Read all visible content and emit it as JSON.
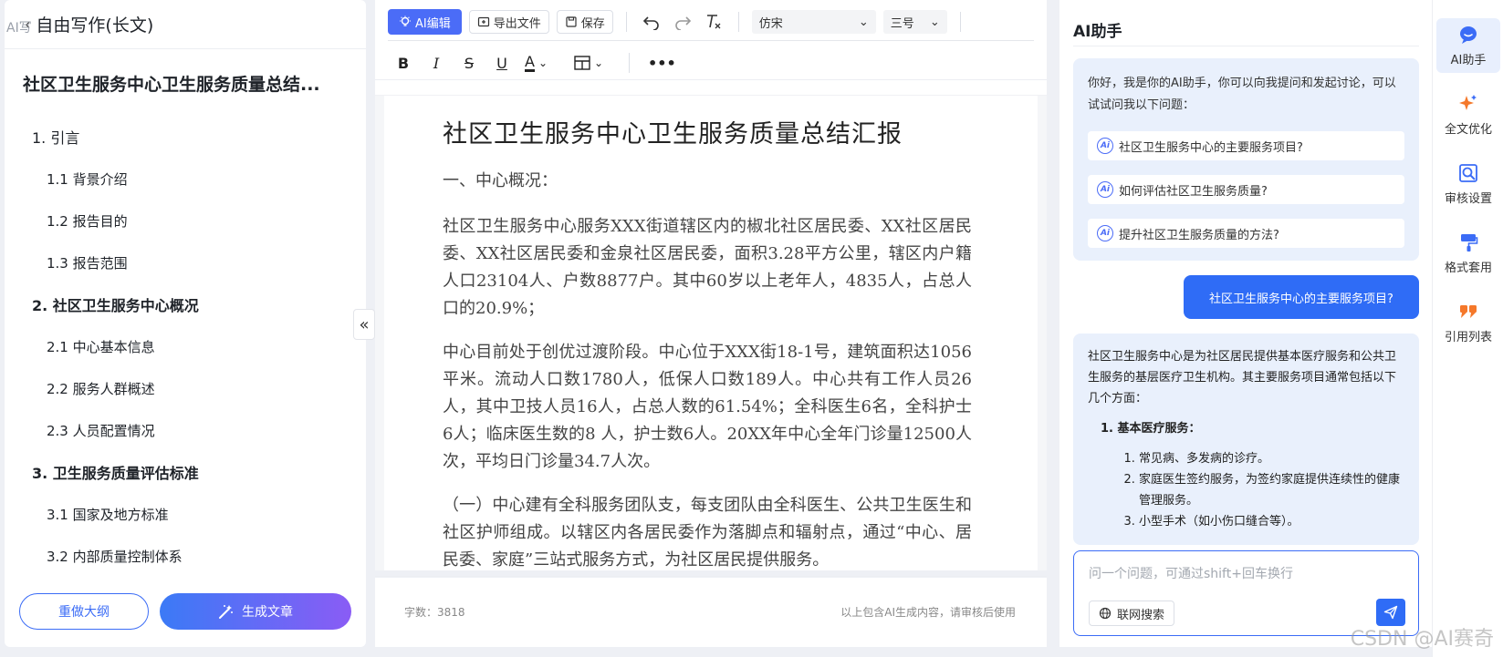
{
  "left": {
    "ghost_label": "AI写",
    "header_title": "自由写作(长文)",
    "doc_title": "社区卫生服务中心卫生服务质量总结...",
    "outline": [
      {
        "level": 1,
        "label": "1. 引言"
      },
      {
        "level": 2,
        "label": "1.1 背景介绍"
      },
      {
        "level": 2,
        "label": "1.2 报告目的"
      },
      {
        "level": 2,
        "label": "1.3 报告范围"
      },
      {
        "level": 1,
        "label": "2. 社区卫生服务中心概况"
      },
      {
        "level": 2,
        "label": "2.1 中心基本信息"
      },
      {
        "level": 2,
        "label": "2.2 服务人群概述"
      },
      {
        "level": 2,
        "label": "2.3 人员配置情况"
      },
      {
        "level": 1,
        "label": "3. 卫生服务质量评估标准"
      },
      {
        "level": 2,
        "label": "3.1 国家及地方标准"
      },
      {
        "level": 2,
        "label": "3.2 内部质量控制体系"
      }
    ],
    "redo_label": "重做大纲",
    "generate_label": "生成文章"
  },
  "toolbar": {
    "ai_edit_label": "AI编辑",
    "export_label": "导出文件",
    "save_label": "保存",
    "font_value": "仿宋",
    "size_value": "三号"
  },
  "document": {
    "title": "社区卫生服务中心卫生服务质量总结汇报",
    "section": "一、中心概况：",
    "paragraphs": [
      "社区卫生服务中心服务XXX街道辖区内的椒北社区居民委、XX社区居民委、XX社区居民委和金泉社区居民委，面积3.28平方公里，辖区内户籍人口23104人、户数8877户。其中60岁以上老年人，4835人，占总人口的20.9%；",
      "中心目前处于创优过渡阶段。中心位于XXX街18-1号，建筑面积达1056平米。流动人口数1780人，低保人口数189人。中心共有工作人员26人，其中卫技人员16人，占总人数的61.54%；全科医生6名，全科护士6人；临床医生数的8 人，护士数6人。20XX年中心全年门诊量12500人次，平均日门诊量34.7人次。",
      "（一）中心建有全科服务团队支，每支团队由全科医生、公共卫生医生和社区护师组成。以辖区内各居民委作为落脚点和辐射点，通过“中心、居民委、家庭”三站式服务方式，为社区居民提供服务。"
    ]
  },
  "editor_footer": {
    "word_count": "字数：3818",
    "disclaimer": "以上包含AI生成内容，请审核后使用"
  },
  "assistant": {
    "title": "AI助手",
    "greeting": "你好，我是你的AI助手，你可以向我提问和发起讨论，可以试试问我以下问题：",
    "ai_badge": "Ai",
    "suggestions": [
      "社区卫生服务中心的主要服务项目?",
      "如何评估社区卫生服务质量?",
      "提升社区卫生服务质量的方法?"
    ],
    "user_message": "社区卫生服务中心的主要服务项目?",
    "answer_intro": "社区卫生服务中心是为社区居民提供基本医疗服务和公共卫生服务的基层医疗卫生机构。其主要服务项目通常包括以下几个方面：",
    "answer_heading": "1. 基本医疗服务：",
    "answer_items": [
      "常见病、多发病的诊疗。",
      "家庭医生签约服务，为签约家庭提供连续性的健康管理服务。",
      "小型手术（如小伤口缝合等）。"
    ],
    "input_placeholder": "问一个问题，可通过shift+回车换行",
    "web_search_label": "联网搜索"
  },
  "rail": [
    {
      "label": "AI助手",
      "icon": "chat-bubble-icon"
    },
    {
      "label": "全文优化",
      "icon": "sparkle-icon"
    },
    {
      "label": "审核设置",
      "icon": "review-search-icon"
    },
    {
      "label": "格式套用",
      "icon": "format-brush-icon"
    },
    {
      "label": "引用列表",
      "icon": "quote-icon"
    }
  ],
  "watermark": "CSDN @AI赛奇",
  "colors": {
    "primary": "#2f6cf6",
    "accent_purple": "#8a5cf5",
    "ai_bubble": "#e9f0fc",
    "orange": "#f5782a"
  }
}
